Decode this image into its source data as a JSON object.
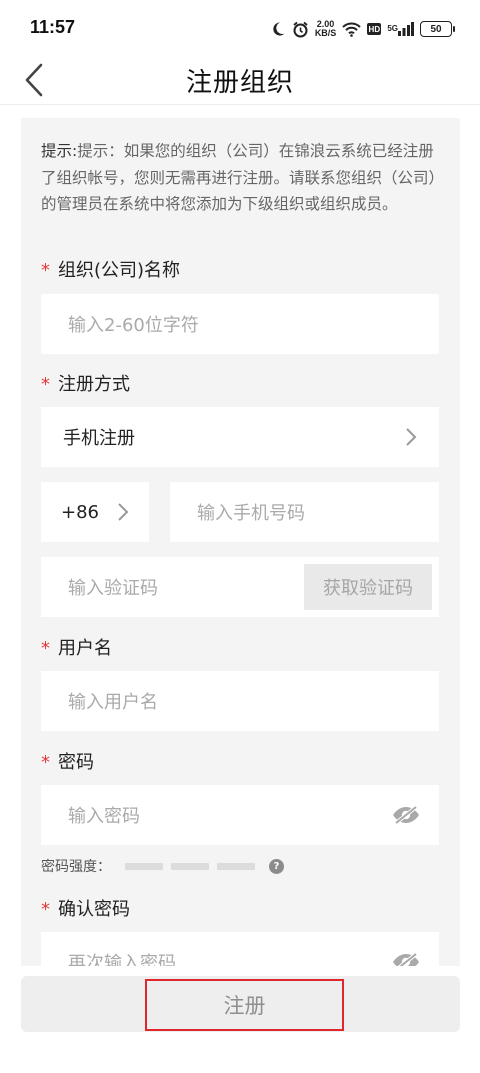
{
  "status_bar": {
    "time": "11:57",
    "net_speed_value": "2.00",
    "net_speed_unit": "KB/S",
    "hd": "HD",
    "signal": "5G",
    "battery": "50",
    "icons": [
      "moon-icon",
      "alarm-icon",
      "wifi-icon",
      "hd-icon",
      "signal-icon",
      "battery-icon"
    ]
  },
  "header": {
    "title": "注册组织",
    "back_icon": "chevron-left-icon"
  },
  "tip": {
    "prefix": "提示:",
    "text": "提示：如果您的组织（公司）在锦浪云系统已经注册了组织帐号，您则无需再进行注册。请联系您组织（公司）的管理员在系统中将您添加为下级组织或组织成员。"
  },
  "required_mark": "*",
  "fields": {
    "org_name": {
      "label": "组织(公司)名称",
      "placeholder": "输入2-60位字符",
      "value": ""
    },
    "register_method": {
      "label": "注册方式",
      "value": "手机注册"
    },
    "phone": {
      "country_code": "+86",
      "placeholder": "输入手机号码"
    },
    "verify_code": {
      "placeholder": "输入验证码",
      "button": "获取验证码"
    },
    "username": {
      "label": "用户名",
      "placeholder": "输入用户名"
    },
    "password": {
      "label": "密码",
      "placeholder": "输入密码"
    },
    "password_strength": {
      "label": "密码强度：",
      "help": "?"
    },
    "confirm_password": {
      "label": "确认密码",
      "placeholder": "再次输入密码"
    }
  },
  "submit": {
    "label": "注册"
  },
  "colors": {
    "required": "#e53935",
    "highlight_border": "#e0282c",
    "card_bg": "#f4f4f4"
  }
}
